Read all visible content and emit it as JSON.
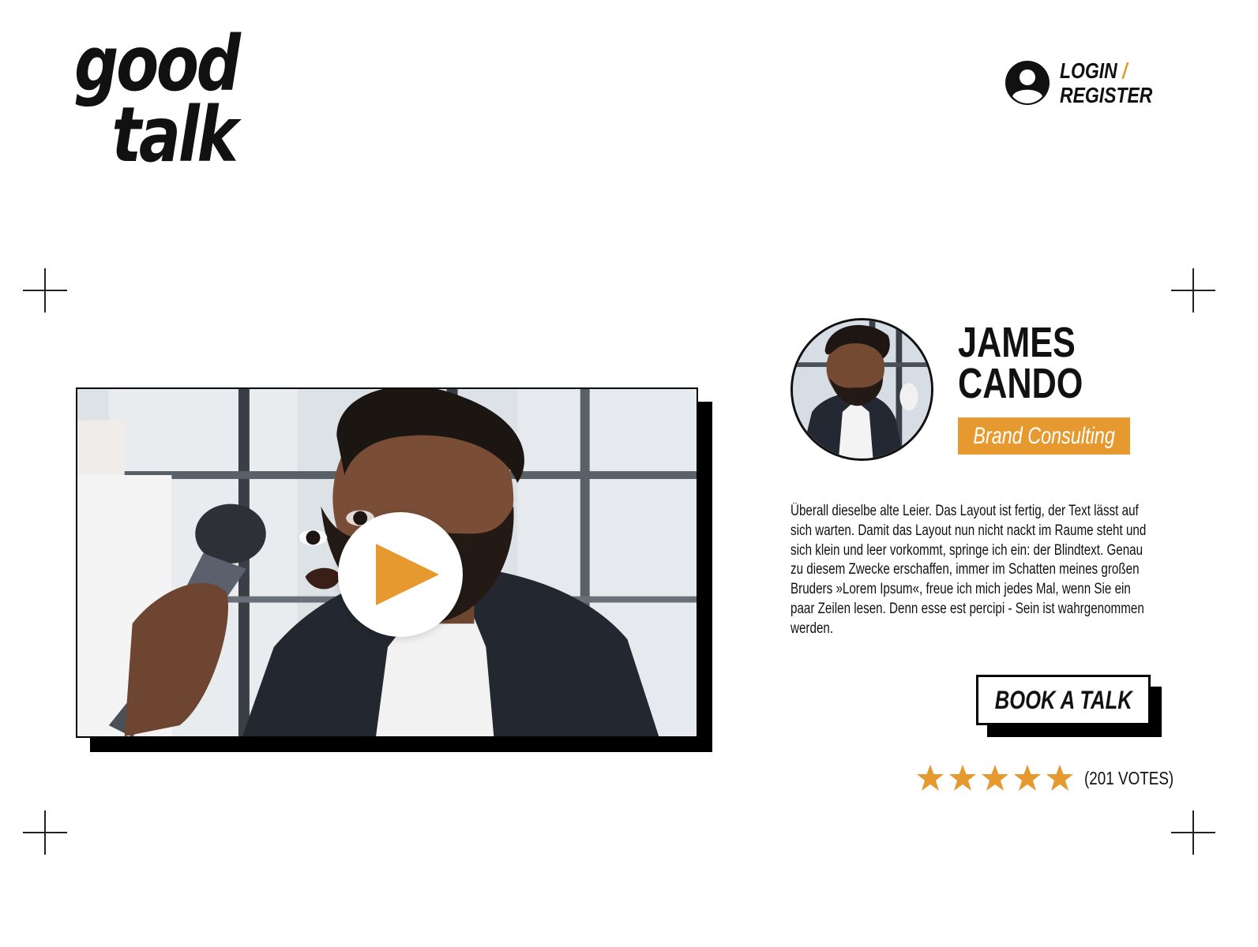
{
  "brand": {
    "line1": "good",
    "line2": "talk"
  },
  "auth": {
    "login": "LOGIN",
    "separator": "/",
    "register": "REGISTER"
  },
  "video": {
    "play_icon": "play-icon"
  },
  "speaker": {
    "first_name": "JAMES",
    "last_name": "CANDO",
    "tag": "Brand Consulting",
    "description": "Überall dieselbe alte Leier. Das Layout ist fertig, der Text lässt auf sich warten. Damit das Layout nun nicht nackt im Raume steht und sich klein und leer vorkommt, springe ich ein: der Blindtext. Genau zu diesem Zwecke erschaffen, immer im Schatten meines großen Bruders »Lorem Ipsum«, freue ich mich jedes Mal, wenn Sie ein paar Zeilen lesen. Denn esse est percipi - Sein ist wahrgenommen werden."
  },
  "cta": {
    "book_label": "BOOK A TALK"
  },
  "rating": {
    "stars": 5,
    "max_stars": 5,
    "votes_label": "(201 VOTES)"
  },
  "colors": {
    "accent": "#e5992e",
    "text": "#111111",
    "background": "#ffffff"
  }
}
